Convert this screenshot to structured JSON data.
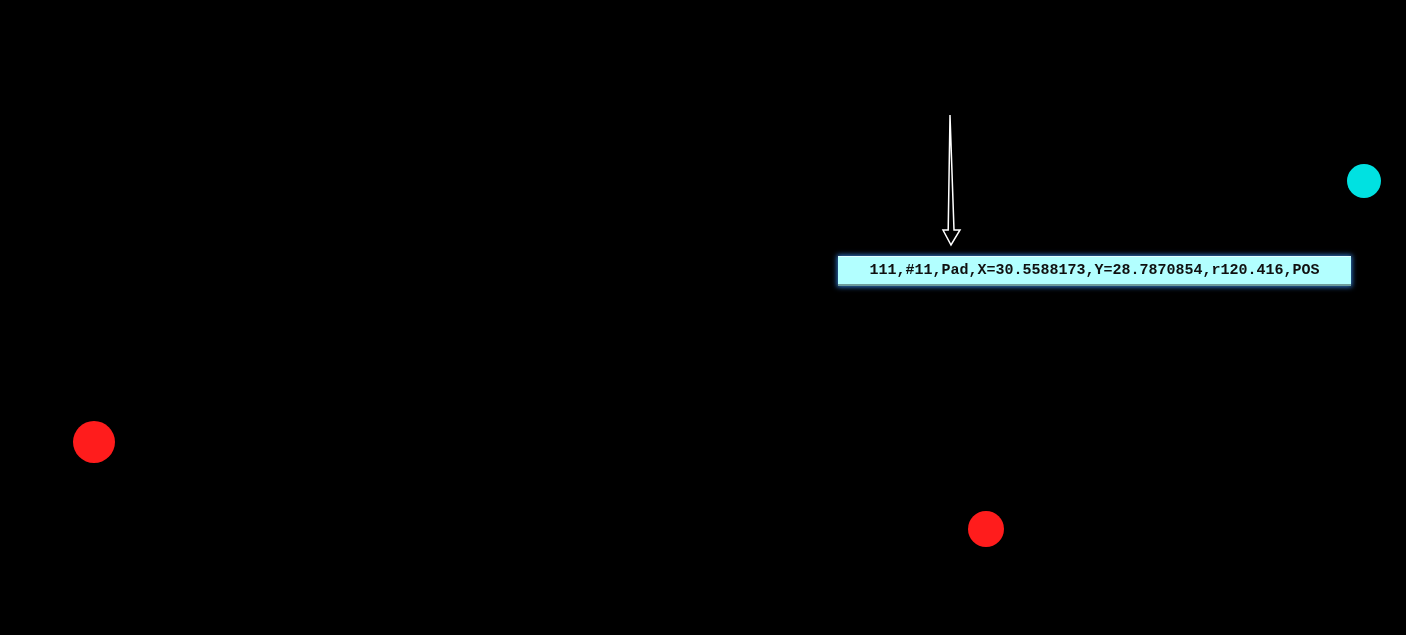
{
  "canvas": {
    "pads": [
      {
        "color": "#00e1e1"
      },
      {
        "color": "#ff1c1c"
      },
      {
        "color": "#ff1c1c"
      }
    ],
    "info_label": {
      "text": "111,#11,Pad,X=30.5588173,Y=28.7870854,r120.416,POS"
    }
  }
}
